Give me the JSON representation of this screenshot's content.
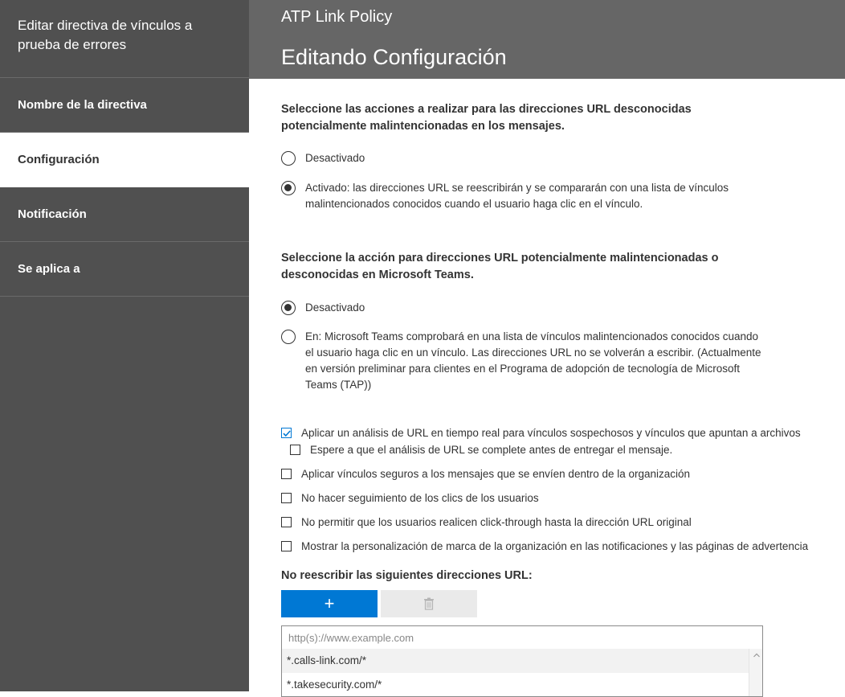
{
  "sidebar": {
    "title": "Editar directiva de vínculos a prueba de errores",
    "items": [
      {
        "label": "Nombre de la directiva",
        "active": false
      },
      {
        "label": "Configuración",
        "active": true
      },
      {
        "label": "Notificación",
        "active": false
      },
      {
        "label": "Se aplica a",
        "active": false
      }
    ]
  },
  "header": {
    "app_title": "ATP Link Policy",
    "page_title": "Editando Configuración"
  },
  "section1": {
    "title": "Seleccione las acciones a realizar para las direcciones URL desconocidas potencialmente malintencionadas en los mensajes.",
    "options": [
      {
        "label": "Desactivado",
        "selected": false
      },
      {
        "label": "Activado: las direcciones URL se reescribirán y se compararán con una lista de vínculos malintencionados conocidos cuando el usuario haga clic en el vínculo.",
        "selected": true
      }
    ]
  },
  "section2": {
    "title": "Seleccione la acción para direcciones URL potencialmente malintencionadas o desconocidas en Microsoft Teams.",
    "options": [
      {
        "label": "Desactivado",
        "selected": true
      },
      {
        "label": "En: Microsoft Teams comprobará en una lista de vínculos malintencionados conocidos cuando el usuario haga clic en un vínculo. Las direcciones URL no se volverán a escribir. (Actualmente en versión preliminar para clientes en el Programa de adopción de tecnología de Microsoft Teams (TAP))",
        "selected": false
      }
    ]
  },
  "checkboxes": [
    {
      "label": "Aplicar un análisis de URL en tiempo real para vínculos sospechosos y vínculos que apuntan a archivos",
      "checked": true
    },
    {
      "label": "Espere a que el análisis de URL se complete antes de entregar el mensaje.",
      "checked": false
    },
    {
      "label": "Aplicar vínculos seguros a los mensajes que se envíen dentro de la organización",
      "checked": false
    },
    {
      "label": "No hacer seguimiento de los clics de los usuarios",
      "checked": false
    },
    {
      "label": "No permitir que los usuarios realicen click-through hasta la dirección URL original",
      "checked": false
    },
    {
      "label": "Mostrar la personalización de marca de la organización en las notificaciones y las páginas de advertencia",
      "checked": false
    }
  ],
  "urls": {
    "title": "No reescribir las siguientes direcciones URL:",
    "add_label": "+",
    "placeholder": "http(s)://www.example.com",
    "items": [
      "*.calls-link.com/*",
      "*.takesecurity.com/*"
    ]
  },
  "icons": {
    "delete": "trash-icon",
    "check": "checkmark-icon",
    "scroll_up": "chevron-up-icon"
  },
  "colors": {
    "sidebar_bg": "#505050",
    "header_bg": "#666666",
    "accent": "#0078d4"
  }
}
